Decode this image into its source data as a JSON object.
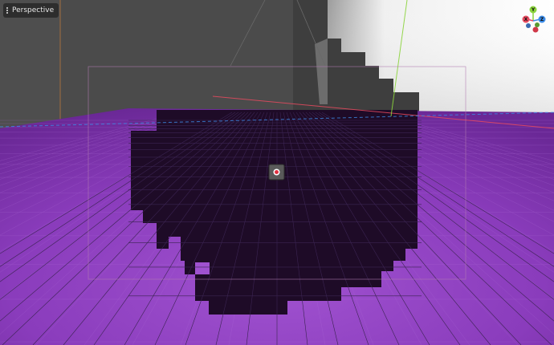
{
  "viewport": {
    "view_menu_label": "Perspective",
    "view_menu_icon": "kebab-menu-icon"
  },
  "gizmo": {
    "x_label": "X",
    "y_label": "Y",
    "z_label": "Z",
    "colors": {
      "x": "#e84a5f",
      "y": "#8bd43c",
      "z": "#3c8ce8"
    }
  },
  "colors": {
    "wall_dark": "#4a4a4a",
    "floor_purple": "#9040c0",
    "void_dark": "#1d0a25",
    "grid_line": "#3a2550",
    "selection_frame": "#b07ab0",
    "axis_red": "#e84a5f",
    "axis_green": "#8bd43c",
    "axis_blue": "#3c8ce8"
  }
}
